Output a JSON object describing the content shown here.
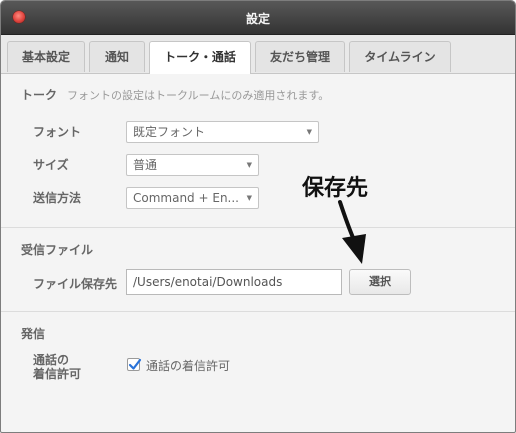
{
  "window": {
    "title": "設定"
  },
  "tabs": [
    "基本設定",
    "通知",
    "トーク・通話",
    "友だち管理",
    "タイムライン"
  ],
  "talk": {
    "heading": "トーク",
    "note": "フォントの設定はトークルームにのみ適用されます。",
    "font_label": "フォント",
    "font_value": "既定フォント",
    "size_label": "サイズ",
    "size_value": "普通",
    "send_label": "送信方法",
    "send_value": "Command + En..."
  },
  "received_files": {
    "heading": "受信ファイル",
    "location_label": "ファイル保存先",
    "location_value": "/Users/enotai/Downloads",
    "select_button": "選択"
  },
  "calls": {
    "heading": "発信",
    "permission_label_line1": "通話の",
    "permission_label_line2": "着信許可",
    "checkbox_label": "通話の着信許可",
    "checkbox_checked": true
  },
  "annotation": {
    "text": "保存先"
  },
  "colors": {
    "accent": "#2a73d9",
    "close": "#e0443e",
    "titlebar": "#3f3f3f"
  }
}
